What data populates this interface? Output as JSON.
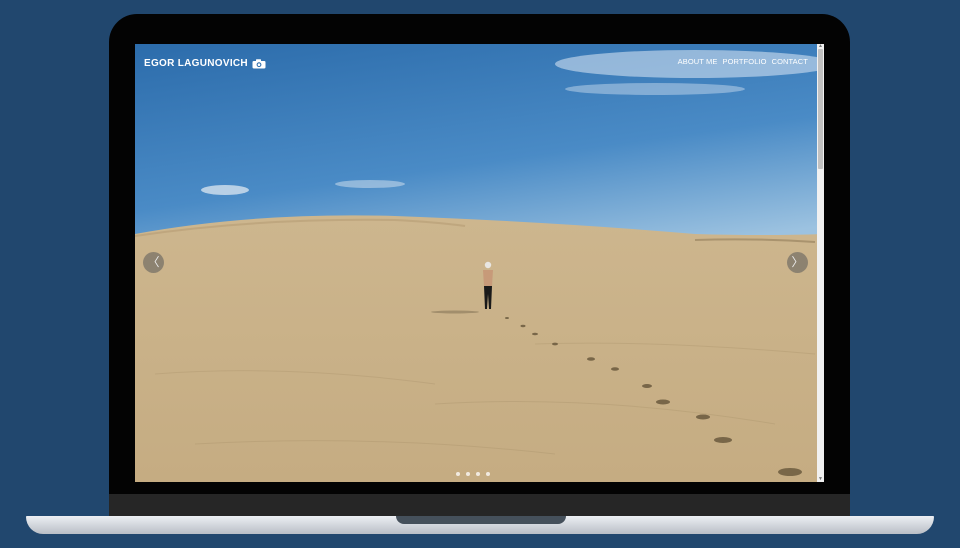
{
  "site": {
    "brand": "EGOR LAGUNOVICH",
    "brand_icon": "camera-icon"
  },
  "nav": {
    "items": [
      "ABOUT ME",
      "PORTFOLIO",
      "CONTACT"
    ]
  },
  "carousel": {
    "prev_symbol": "〈",
    "next_symbol": "〉",
    "slide_count": 4
  },
  "colors": {
    "background": "#21476e",
    "sky_top": "#2f6fae",
    "sand": "#cbb48b"
  }
}
